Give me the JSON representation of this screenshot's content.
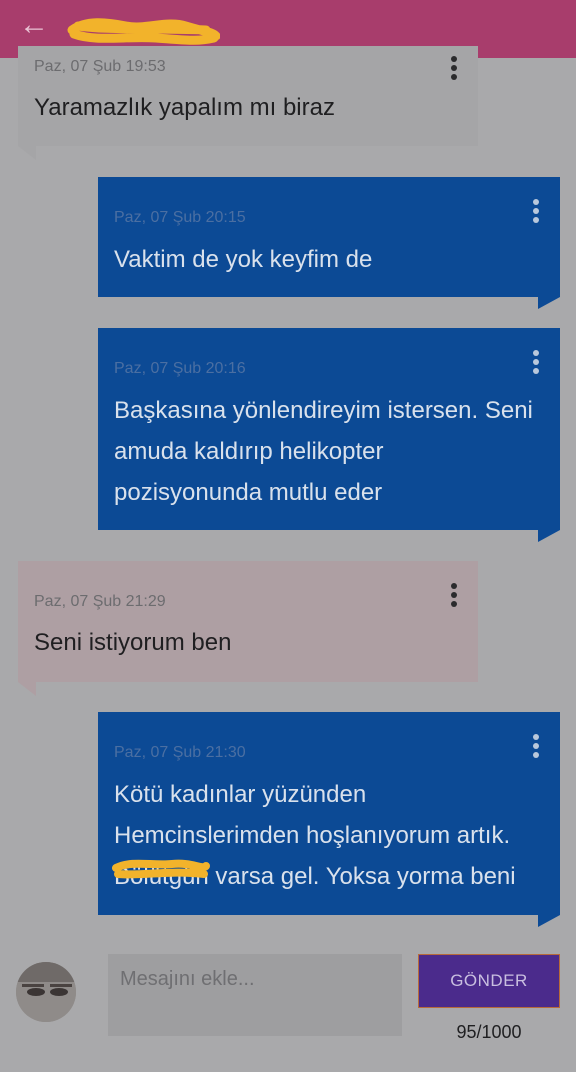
{
  "header": {
    "back_icon": "arrow-left-icon",
    "back_glyph": "←",
    "title_redacted_color": "#f2b32b"
  },
  "messages": [
    {
      "side": "received",
      "time": "Paz, 07 Şub 19:53",
      "lines": [
        "Yaramazlık yapalım mı biraz"
      ]
    },
    {
      "side": "sent",
      "time": "Paz, 07 Şub 20:15",
      "lines": [
        "Vaktim de yok keyfim de"
      ]
    },
    {
      "side": "sent",
      "time": "Paz, 07 Şub 20:16",
      "lines": [
        "Başkasına yönlendireyim istersen. Seni",
        "amuda kaldırıp helikopter",
        "pozisyonunda mutlu eder"
      ]
    },
    {
      "side": "received",
      "time": "Paz, 07 Şub 21:29",
      "lines": [
        "Seni istiyorum ben"
      ]
    },
    {
      "side": "sent",
      "time": "Paz, 07 Şub 21:30",
      "lines": [
        "Kötü kadınlar yüzünden",
        "Hemcinslerimden hoşlanıyorum artık.",
        "Bölütgün varsa gel. Yoksa yorma beni"
      ]
    }
  ],
  "composer": {
    "placeholder": "Mesajını ekle...",
    "value": "",
    "send_label": "GÖNDER",
    "char_counter": "95/1000"
  },
  "icons": {
    "message_menu": "more-vertical-icon",
    "avatar": "user-avatar"
  },
  "colors": {
    "appbar": "#a83d6c",
    "sent_bubble": "#0c4a95",
    "received_bubble": "#a5a5a7",
    "received_bubble_pink": "#ae9fa3",
    "send_button": "#4b2b8c"
  }
}
